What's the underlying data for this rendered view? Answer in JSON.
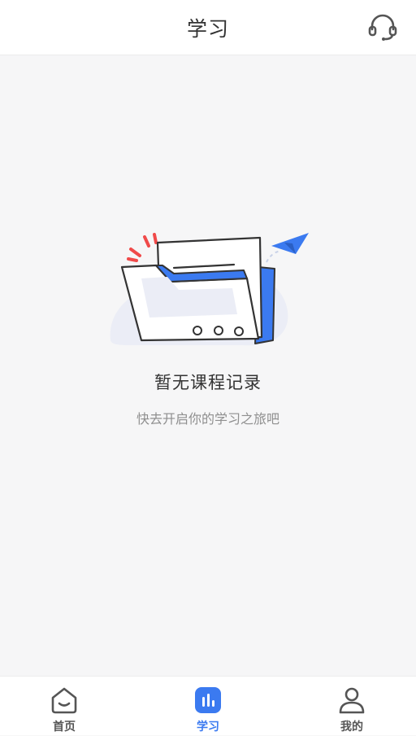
{
  "header": {
    "title": "学习",
    "support_icon": "headset-icon"
  },
  "empty_state": {
    "title": "暂无课程记录",
    "subtitle": "快去开启你的学习之旅吧",
    "illustration_icon": "empty-folder-illustration"
  },
  "tabbar": {
    "active_tab": "学习",
    "tabs": [
      {
        "label": "首页",
        "icon": "home-icon"
      },
      {
        "label": "学习",
        "icon": "study-chart-icon"
      },
      {
        "label": "我的",
        "icon": "user-icon"
      }
    ]
  },
  "colors": {
    "accent": "#3b7af0",
    "background": "#f6f6f7",
    "title_text": "#333333",
    "subtitle_text": "#8f8f8f",
    "red_accent": "#f04a4a"
  }
}
